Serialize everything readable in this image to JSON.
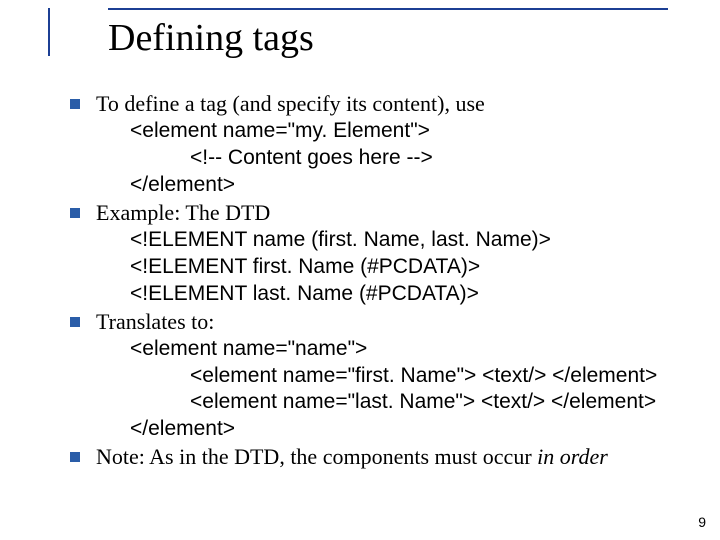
{
  "title": "Defining tags",
  "b1": {
    "lead": "To define a tag (and specify its content), use",
    "code1": "<element name=\"my. Element\">",
    "code2": "<!-- Content goes here -->",
    "code3": "</element>"
  },
  "b2": {
    "lead": "Example: The DTD",
    "code1": "<!ELEMENT name (first. Name, last. Name)>",
    "code2": "<!ELEMENT first. Name (#PCDATA)>",
    "code3": "<!ELEMENT last. Name (#PCDATA)>"
  },
  "b3": {
    "lead": "Translates to:",
    "code1": "<element name=\"name\">",
    "code2": "<element name=\"first. Name\"> <text/> </element>",
    "code3": "<element name=\"last. Name\"> <text/> </element>",
    "code4": "</element>"
  },
  "b4": {
    "prefix": "Note: As in the DTD, the components must occur ",
    "emph": "in order"
  },
  "pagenum": "9"
}
